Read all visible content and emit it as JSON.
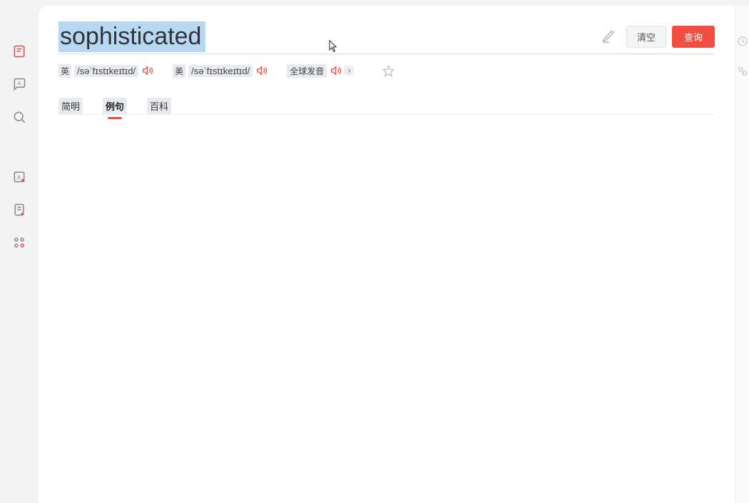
{
  "search": {
    "word": "sophisticated",
    "clear_label": "清空",
    "search_label": "查询"
  },
  "pron": {
    "uk_lang": "英",
    "uk_ipa": "/səˈfɪstɪkeɪtɪd/",
    "us_lang": "美",
    "us_ipa": "/səˈfɪstɪkeɪtɪd/",
    "global_label": "全球发音"
  },
  "tabs": [
    {
      "label": "简明"
    },
    {
      "label": "例句"
    },
    {
      "label": "百科"
    }
  ],
  "active_tab_index": 1,
  "colors": {
    "accent": "#ef4e40",
    "highlight": "#b7d8f4"
  }
}
